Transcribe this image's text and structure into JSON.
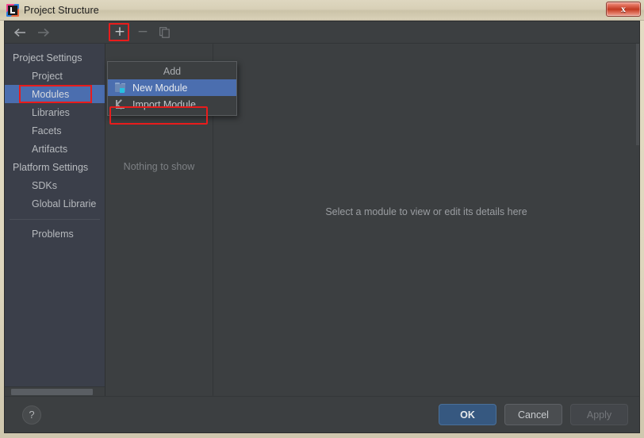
{
  "window": {
    "title": "Project Structure",
    "app_icon": "intellij-idea-icon",
    "close_label": "x"
  },
  "toolbar": {
    "back_icon": "arrow-left-icon",
    "forward_icon": "arrow-right-icon",
    "add_label": "+",
    "remove_label": "−",
    "copy_icon": "copy-icon"
  },
  "sidebar": {
    "items": [
      {
        "label": "Project Settings",
        "type": "group",
        "selected": false
      },
      {
        "label": "Project",
        "type": "child",
        "selected": false
      },
      {
        "label": "Modules",
        "type": "child",
        "selected": true
      },
      {
        "label": "Libraries",
        "type": "child",
        "selected": false
      },
      {
        "label": "Facets",
        "type": "child",
        "selected": false
      },
      {
        "label": "Artifacts",
        "type": "child",
        "selected": false
      },
      {
        "label": "Platform Settings",
        "type": "group",
        "selected": false
      },
      {
        "label": "SDKs",
        "type": "child",
        "selected": false
      },
      {
        "label": "Global Librarie",
        "type": "child",
        "selected": false
      }
    ],
    "problems_label": "Problems"
  },
  "module_list": {
    "empty_text": "Nothing to show"
  },
  "detail": {
    "message": "Select a module to view or edit its details here"
  },
  "add_menu": {
    "header": "Add",
    "items": [
      {
        "label": "New Module",
        "icon": "new-module-icon",
        "highlighted": true
      },
      {
        "label": "Import Module",
        "icon": "import-module-icon",
        "highlighted": false
      }
    ]
  },
  "bottom": {
    "help_label": "?",
    "ok_label": "OK",
    "cancel_label": "Cancel",
    "apply_label": "Apply"
  },
  "colors": {
    "accent_selection": "#4b6eaf",
    "primary_button": "#365880",
    "annotation": "#e81c1c",
    "panel_bg": "#3c3f41",
    "sidebar_bg": "#3b3f4a",
    "titlebar_bg": "#d8d0b7"
  }
}
